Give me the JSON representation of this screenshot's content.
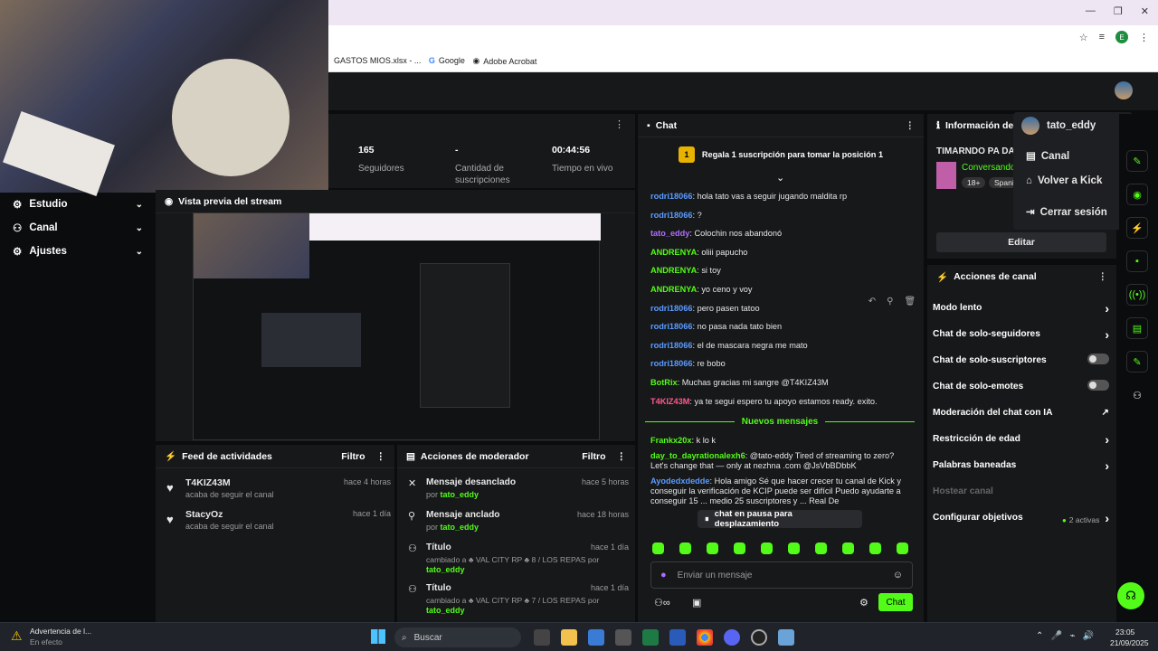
{
  "browser": {
    "bookmarks": [
      "GASTOS MIOS.xlsx - ...",
      "Google",
      "Adobe Acrobat"
    ],
    "profile_letter": "E"
  },
  "left_nav": [
    {
      "label": "Estudio"
    },
    {
      "label": "Canal"
    },
    {
      "label": "Ajustes"
    }
  ],
  "stats": [
    {
      "value": "165",
      "label": "Seguidores"
    },
    {
      "value": "-",
      "label": "Cantidad de suscripciones"
    },
    {
      "value": "00:44:56",
      "label": "Tiempo en vivo"
    }
  ],
  "stream_preview": {
    "title": "Vista previa del stream"
  },
  "feed": {
    "title": "Feed de actividades",
    "filter": "Filtro",
    "items": [
      {
        "user": "T4KIZ43M",
        "desc": "acaba de seguir el canal",
        "time": "hace 4 horas"
      },
      {
        "user": "StacyOz",
        "desc": "acaba de seguir el canal",
        "time": "hace 1 día"
      }
    ]
  },
  "mod_actions": {
    "title": "Acciones de moderador",
    "filter": "Filtro",
    "items": [
      {
        "action": "Mensaje desanclado",
        "by_prefix": "por ",
        "by": "tato_eddy",
        "time": "hace 5 horas"
      },
      {
        "action": "Mensaje anclado",
        "by_prefix": "por ",
        "by": "tato_eddy",
        "time": "hace 18 horas"
      },
      {
        "action": "Título",
        "detail": "cambiado a ♣ VAL CITY RP ♣ 8 / LOS REPAS por",
        "by": "tato_eddy",
        "time": "hace 1 día"
      },
      {
        "action": "Título",
        "detail": "cambiado a ♣ VAL CITY RP ♣ 7 / LOS REPAS por",
        "by": "tato_eddy",
        "time": "hace 1 día"
      }
    ]
  },
  "chat": {
    "title": "Chat",
    "gift_banner": "Regala 1 suscripción para tomar la posición 1",
    "gift_position": "1",
    "messages": [
      {
        "user": "rodri18066",
        "color": "b",
        "text": ": hola tato vas a seguir jugando maldita rp"
      },
      {
        "user": "rodri18066",
        "color": "b",
        "text": ": ?"
      },
      {
        "user": "tato_eddy",
        "color": "p",
        "text": ": Colochin nos abandonó"
      },
      {
        "user": "ANDRENYA",
        "color": "g",
        "text": ": oliii papucho"
      },
      {
        "user": "ANDRENYA",
        "color": "g",
        "text": ": si toy"
      },
      {
        "user": "ANDRENYA",
        "color": "g",
        "text": ": yo ceno y voy"
      },
      {
        "user": "rodri18066",
        "color": "b",
        "text": ": pero pasen tatoo"
      },
      {
        "user": "rodri18066",
        "color": "b",
        "text": ": no pasa nada tato bien"
      },
      {
        "user": "rodri18066",
        "color": "b",
        "text": ": el de mascara negra me mato"
      },
      {
        "user": "rodri18066",
        "color": "b",
        "text": ": re bobo"
      },
      {
        "user": "BotRix",
        "color": "g",
        "text": ": Muchas gracias mi sangre @T4KIZ43M"
      },
      {
        "user": "T4KIZ43M",
        "color": "r",
        "text": ": ya te segui espero tu apoyo estamos ready. exito."
      }
    ],
    "new_divider": "Nuevos mensajes",
    "new_messages": [
      {
        "user": "Frankx20x",
        "color": "g",
        "text": ": k lo k"
      },
      {
        "user": "day_to_dayrationalexh6",
        "color": "g",
        "text": ": @tato-eddy Tired of streaming to zero? Let's change that — only at nezhna .com @JsVbBDbbK"
      },
      {
        "user": "Ayodedxdedde",
        "color": "b",
        "text": ": Hola amigo Sé que hacer crecer tu canal de Kick y conseguir la verificación de KCIP puede ser difícil Puedo ayudarte a conseguir 15 ... medio 25 suscriptores y ... Real De"
      }
    ],
    "paused": "chat en pausa para desplazamiento",
    "input_placeholder": "Enviar un mensaje",
    "send": "Chat"
  },
  "info": {
    "title": "Información del s",
    "stream_title": "TIMARNDO PA DAR",
    "category": "Conversando",
    "tags": [
      "18+",
      "Spani"
    ],
    "edit": "Editar"
  },
  "user_menu": {
    "username": "tato_eddy",
    "items": [
      "Canal",
      "Volver a Kick",
      "Cerrar sesión"
    ]
  },
  "channel_actions": {
    "title": "Acciones de canal",
    "rows": [
      {
        "label": "Modo lento",
        "control": "chevron"
      },
      {
        "label": "Chat de solo-seguidores",
        "control": "chevron"
      },
      {
        "label": "Chat de solo-suscriptores",
        "control": "toggle"
      },
      {
        "label": "Chat de solo-emotes",
        "control": "toggle"
      },
      {
        "label": "Moderación del chat con IA",
        "control": "external"
      },
      {
        "label": "Restricción de edad",
        "control": "chevron"
      },
      {
        "label": "Palabras baneadas",
        "control": "chevron"
      },
      {
        "label": "Hostear canal",
        "control": "none"
      },
      {
        "label": "Configurar objetivos",
        "control": "chevron",
        "extra": "2 activas"
      }
    ]
  },
  "taskbar": {
    "notice_title": "Advertencia de l...",
    "notice_sub": "En efecto",
    "search": "Buscar",
    "time": "23:05",
    "date": "21/09/2025"
  }
}
